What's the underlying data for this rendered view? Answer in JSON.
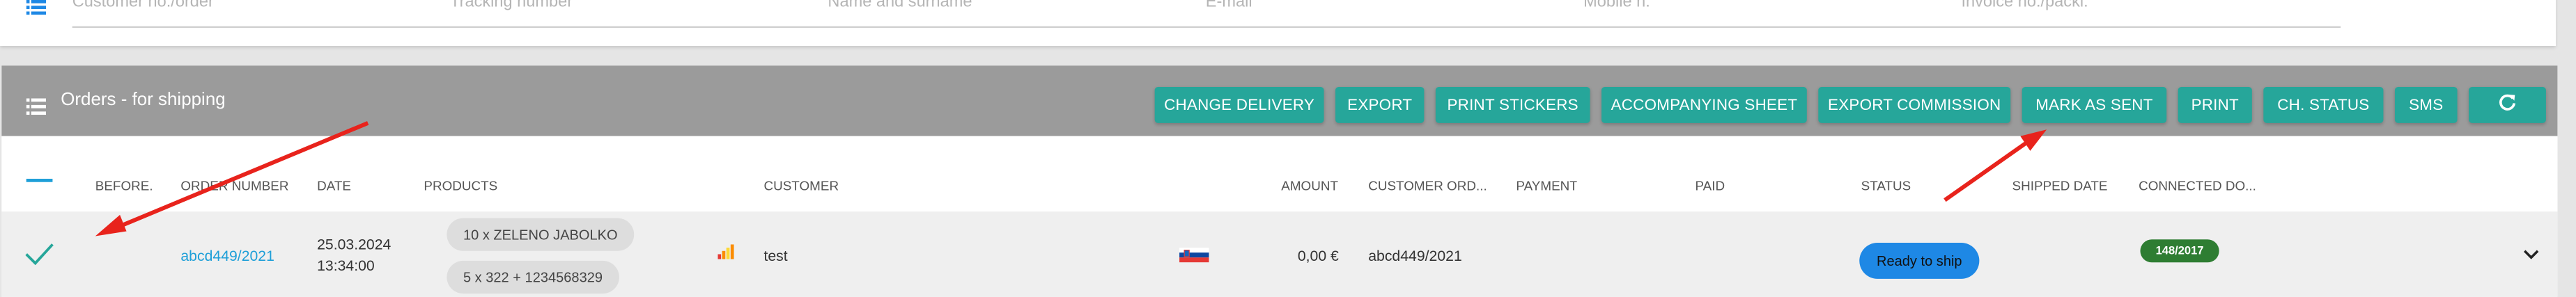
{
  "filters": {
    "fields": [
      "Customer no./order",
      "Tracking number",
      "Name and surname",
      "E-mail",
      "Mobile n.",
      "Invoice no./packl."
    ]
  },
  "panel": {
    "title": "Orders - for shipping",
    "buttons": {
      "change_delivery": "CHANGE DELIVERY",
      "export": "EXPORT",
      "print_stickers": "PRINT STICKERS",
      "accompanying_sheet": "ACCOMPANYING SHEET",
      "export_commission": "EXPORT COMMISSION",
      "mark_as_sent": "MARK AS SENT",
      "print": "PRINT",
      "ch_status": "CH. STATUS",
      "sms": "SMS",
      "refresh_icon": "refresh-icon"
    }
  },
  "table": {
    "columns": {
      "before": "BEFORE.",
      "order_number": "ORDER NUMBER",
      "date": "DATE",
      "products": "PRODUCTS",
      "customer": "CUSTOMER",
      "amount": "AMOUNT",
      "customer_order": "CUSTOMER ORD...",
      "payment": "PAYMENT",
      "paid": "PAID",
      "status": "STATUS",
      "shipped_date": "SHIPPED DATE",
      "connected_docs": "CONNECTED DO..."
    },
    "rows": [
      {
        "order_number": "abcd449/2021",
        "date": "25.03.2024",
        "time": "13:34:00",
        "products": [
          "10 x ZELENO JABOLKO",
          "5 x 322 + 1234568329"
        ],
        "customer": "test",
        "country_flag": "slovenia-flag",
        "amount": "0,00 €",
        "customer_order": "abcd449/2021",
        "status": "Ready to ship",
        "connected_doc": "148/2017"
      }
    ]
  },
  "colors": {
    "accent_teal": "#26a69a",
    "header_gray": "#9b9b9b",
    "link_blue": "#1e9fd8",
    "status_blue": "#1e88e5",
    "doc_green": "#2e7d32",
    "annotation_red": "#e8231c"
  }
}
